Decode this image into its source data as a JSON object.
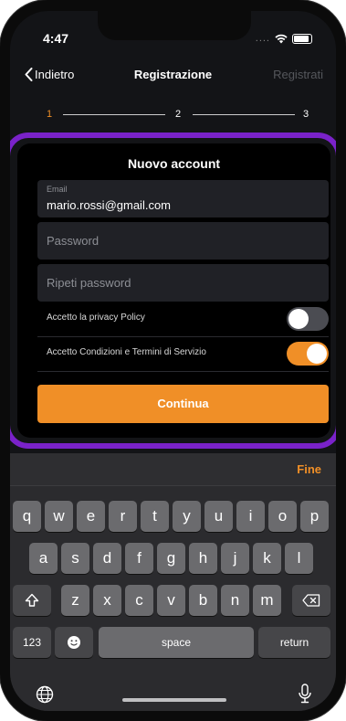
{
  "status_bar": {
    "time": "4:47",
    "signal": "...."
  },
  "nav": {
    "back_label": "Indietro",
    "title": "Registrazione",
    "action_label": "Registrati"
  },
  "stepper": {
    "steps": [
      "1",
      "2",
      "3"
    ],
    "active_color": "#f08f27"
  },
  "form": {
    "title": "Nuovo account",
    "email": {
      "label": "Email",
      "value": "mario.rossi@gmail.com"
    },
    "password": {
      "placeholder": "Password"
    },
    "repeat_password": {
      "placeholder": "Ripeti password"
    },
    "privacy": {
      "label": "Accetto la privacy Policy",
      "checked": false
    },
    "terms": {
      "label": "Accetto Condizioni e Termini di Servizio",
      "checked": true
    },
    "submit_label": "Continua"
  },
  "keyboard": {
    "done_label": "Fine",
    "row1": [
      "q",
      "w",
      "e",
      "r",
      "t",
      "y",
      "u",
      "i",
      "o",
      "p"
    ],
    "row2": [
      "a",
      "s",
      "d",
      "f",
      "g",
      "h",
      "j",
      "k",
      "l"
    ],
    "row3": [
      "z",
      "x",
      "c",
      "v",
      "b",
      "n",
      "m"
    ],
    "numbers_label": "123",
    "space_label": "space",
    "return_label": "return"
  },
  "colors": {
    "accent": "#f08f27",
    "highlight_border": "#7a22c9",
    "background": "#131417"
  }
}
